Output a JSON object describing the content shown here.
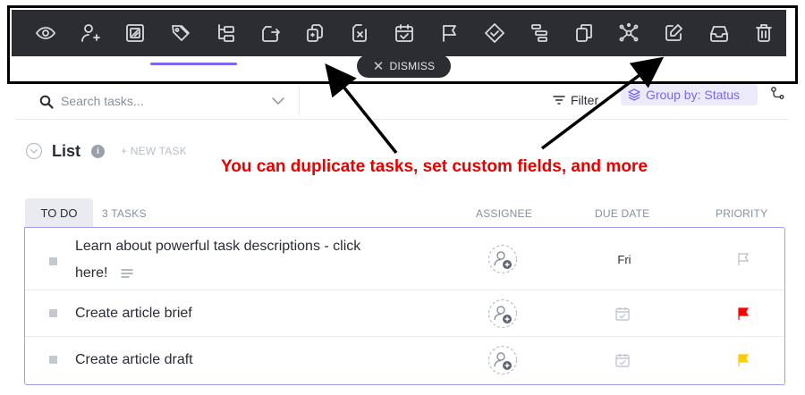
{
  "toolbar": {
    "buttons": [
      {
        "name": "watch-icon",
        "label": "Watch"
      },
      {
        "name": "assign-icon",
        "label": "Assign"
      },
      {
        "name": "custom-fields-icon",
        "label": "Custom fields"
      },
      {
        "name": "tags-icon",
        "label": "Tags"
      },
      {
        "name": "subtasks-icon",
        "label": "Convert to subtask"
      },
      {
        "name": "move-icon",
        "label": "Move"
      },
      {
        "name": "duplicate-icon",
        "label": "Duplicate"
      },
      {
        "name": "remove-icon",
        "label": "Remove from list"
      },
      {
        "name": "due-date-icon",
        "label": "Set due date"
      },
      {
        "name": "priority-flag-icon",
        "label": "Set priority"
      },
      {
        "name": "status-icon",
        "label": "Set status"
      },
      {
        "name": "dependencies-icon",
        "label": "Dependencies"
      },
      {
        "name": "copy-icon",
        "label": "Copy"
      },
      {
        "name": "relationships-icon",
        "label": "Relationships"
      },
      {
        "name": "edit-icon",
        "label": "Edit"
      },
      {
        "name": "archive-icon",
        "label": "Archive"
      },
      {
        "name": "delete-icon",
        "label": "Delete"
      }
    ],
    "dismiss_label": "DISMISS"
  },
  "search": {
    "placeholder": "Search tasks..."
  },
  "actions": {
    "filter_label": "Filter",
    "group_label": "Group by: Status"
  },
  "list": {
    "title": "List",
    "info_symbol": "i",
    "new_task_label": "+ NEW TASK"
  },
  "status_group": {
    "label": "TO DO",
    "count_label": "3 TASKS"
  },
  "columns": {
    "assignee": "ASSIGNEE",
    "due_date": "DUE DATE",
    "priority": "PRIORITY"
  },
  "tasks": [
    {
      "line1": "Learn about powerful task descriptions - click",
      "line2": "here!",
      "due": "Fri",
      "priority": "none",
      "priority_color": "#b9bec7"
    },
    {
      "name": "Create article brief",
      "due": "",
      "priority": "urgent",
      "priority_color": "#ff0000"
    },
    {
      "name": "Create article draft",
      "due": "",
      "priority": "high",
      "priority_color": "#ffcc00"
    }
  ],
  "annotation": {
    "text": "You can duplicate tasks, set custom fields, and more"
  },
  "colors": {
    "toolbar_bg": "#2b2d33",
    "accent": "#7b68ee",
    "annotation_red": "#e60000"
  }
}
